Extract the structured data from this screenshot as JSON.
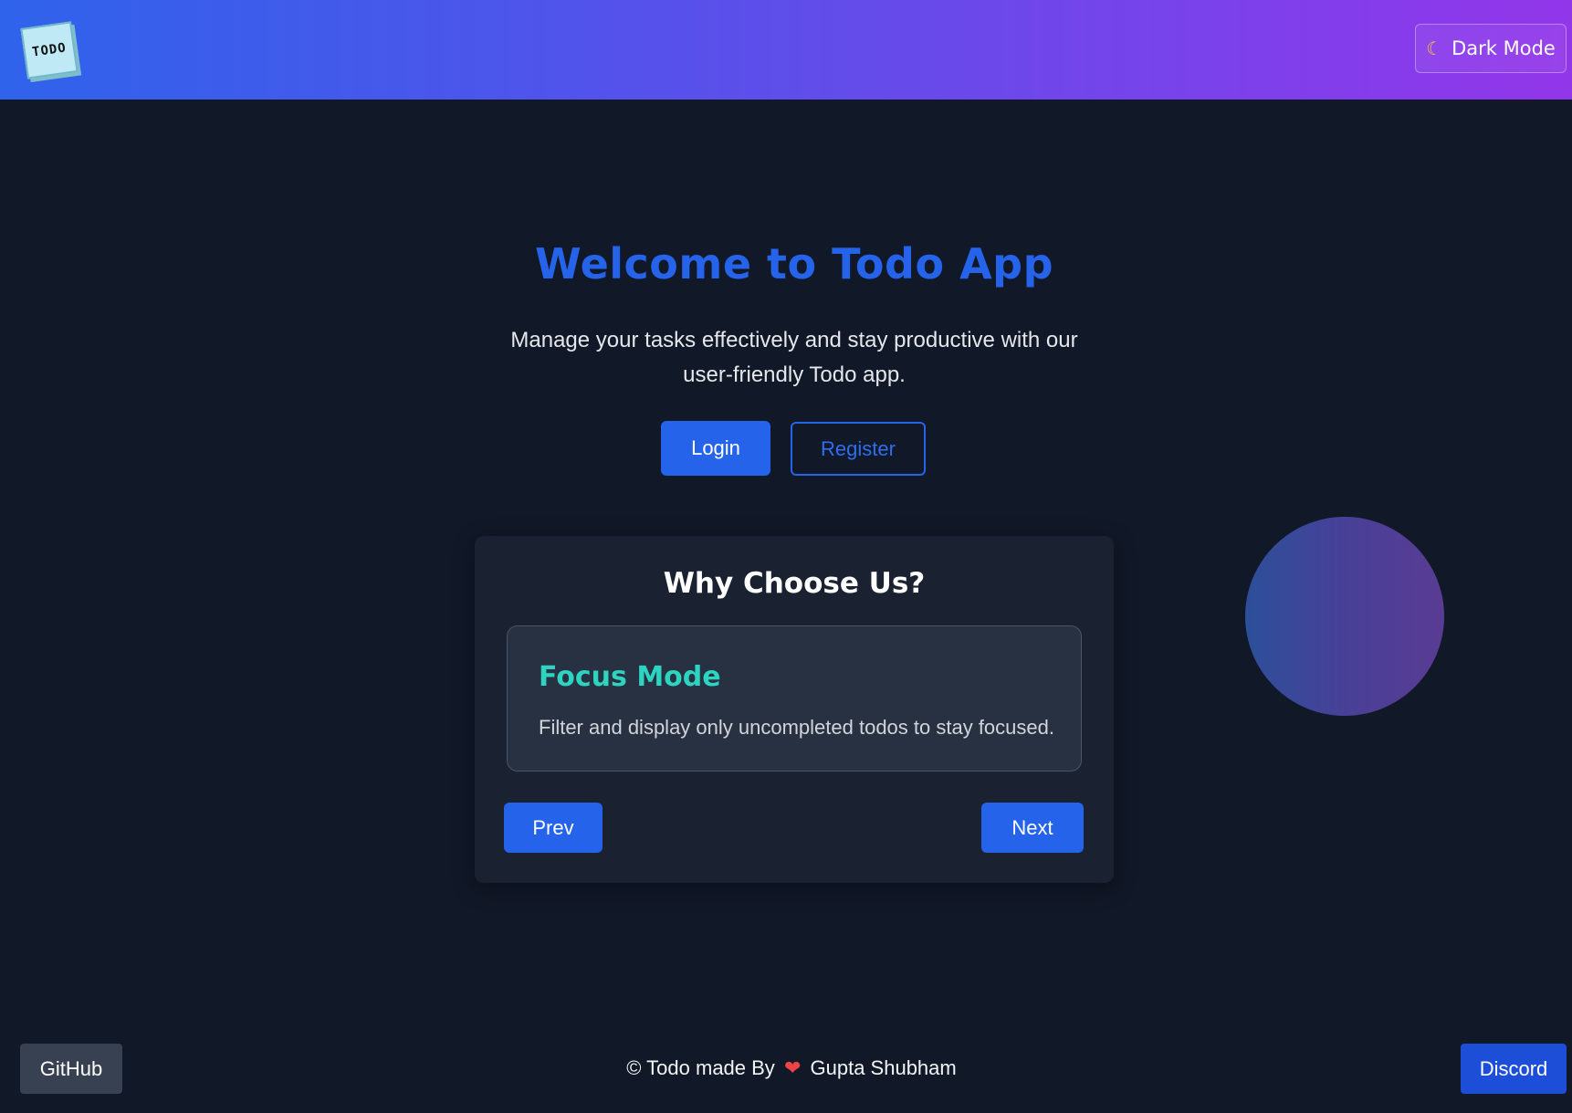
{
  "header": {
    "logo_text": "TODO",
    "theme_toggle_label": "Dark Mode",
    "gradient_start": "#2f63eb",
    "gradient_end": "#9236ea"
  },
  "hero": {
    "title": "Welcome to Todo App",
    "subtitle": "Manage your tasks effectively and stay productive with our user-friendly Todo app.",
    "login_label": "Login",
    "register_label": "Register"
  },
  "features": {
    "title": "Why Choose Us?",
    "current": {
      "title": "Focus Mode",
      "description": "Filter and display only uncompleted todos to stay focused."
    },
    "prev_label": "Prev",
    "next_label": "Next"
  },
  "footer": {
    "github_label": "GitHub",
    "discord_label": "Discord",
    "copyright_prefix": "© Todo made By",
    "author": "Gupta Shubham"
  },
  "colors": {
    "background": "#111827",
    "accent": "#2563eb",
    "feature_title": "#2dd4bf",
    "heart": "#ef4444"
  },
  "icons": {
    "theme_icon": "moon-icon",
    "heart_icon": "heart-icon"
  }
}
